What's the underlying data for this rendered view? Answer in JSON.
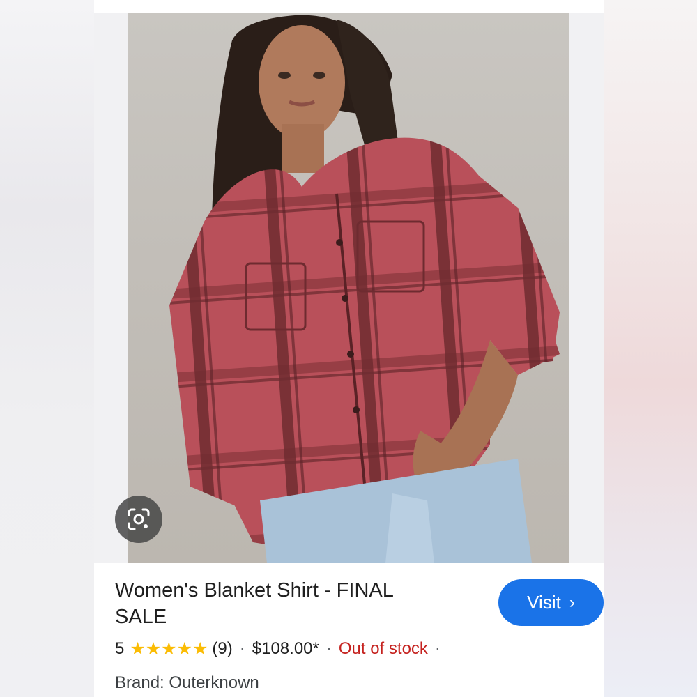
{
  "product": {
    "title": "Women's Blanket Shirt - FINAL SALE",
    "rating_value": "5",
    "stars": "★★★★★",
    "review_count": "(9)",
    "price": "$108.00*",
    "availability": "Out of stock",
    "brand_line": "Brand: Outerknown"
  },
  "actions": {
    "visit_label": "Visit",
    "visit_chevron": "›"
  },
  "separators": {
    "dot": "·"
  },
  "colors": {
    "accent_blue": "#1a73e8",
    "star_yellow": "#fbbc04",
    "out_of_stock_red": "#c5221f"
  },
  "icons": {
    "lens": "google-lens-icon"
  }
}
